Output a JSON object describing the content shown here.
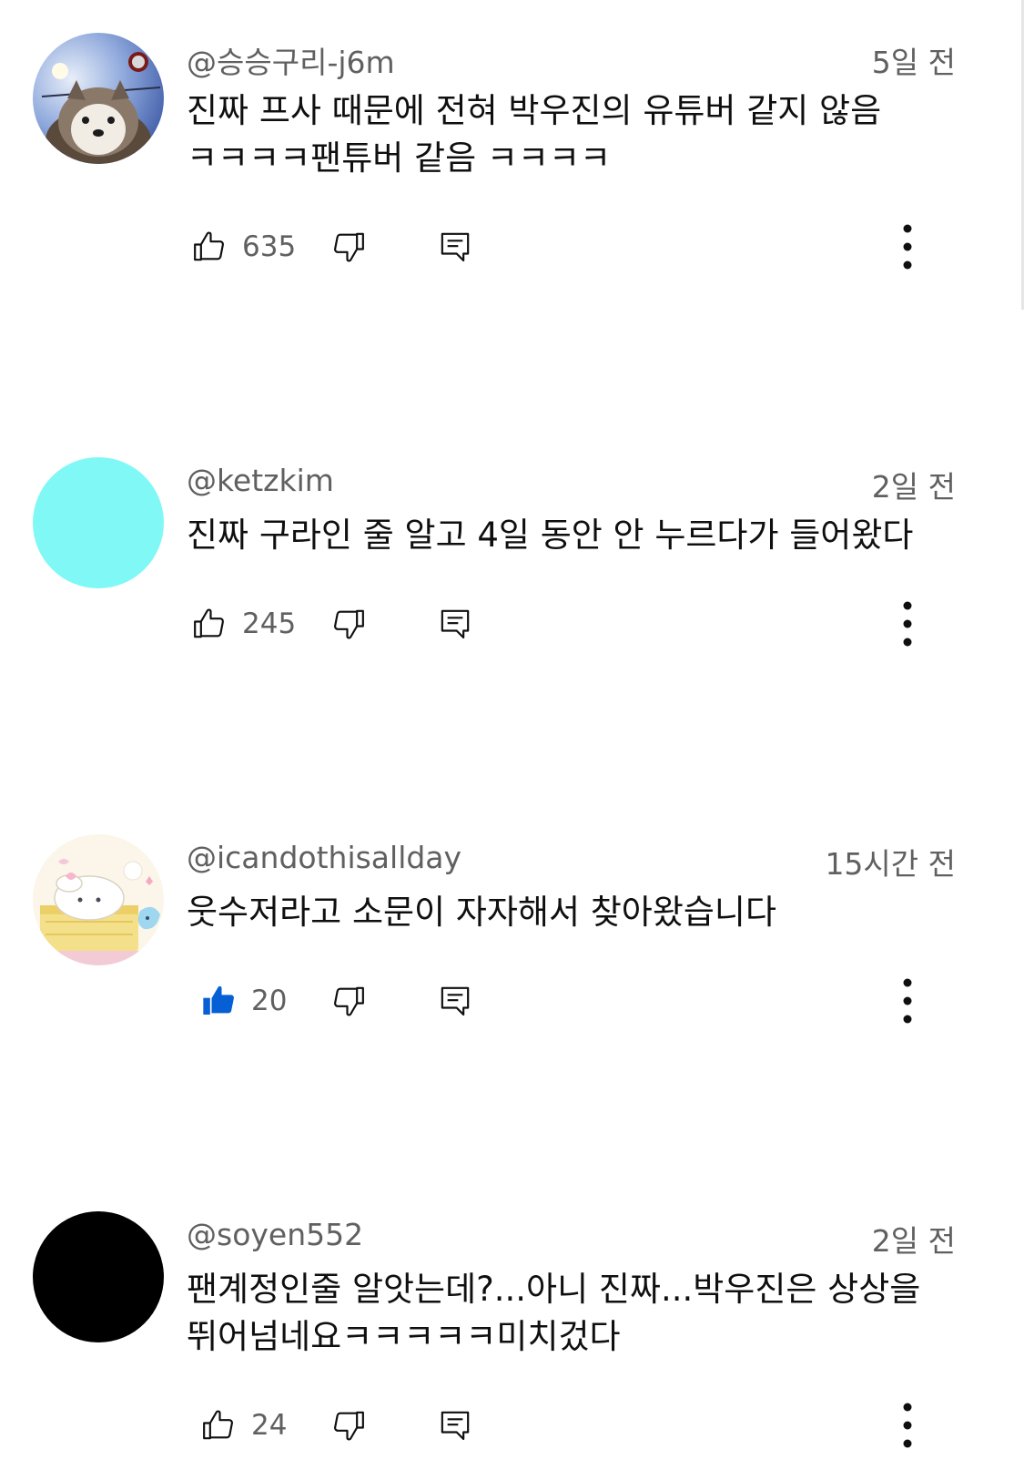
{
  "comments": [
    {
      "author": "@승승구리-j6m",
      "time": "5일 전",
      "text": "진짜 프사 때문에 전혀 박우진의 유튜버 같지 않음 ㅋㅋㅋㅋ팬튜버 같음 ㅋㅋㅋㅋ",
      "likes": "635",
      "liked": false,
      "avatar": "husky-dog-photo"
    },
    {
      "author": "@ketzkim",
      "time": "2일 전",
      "text": "진짜 구라인 줄 알고 4일 동안 안 누르다가 들어왔다",
      "likes": "245",
      "liked": false,
      "avatar": "cyan-circle",
      "avatar_color": "#80f8f6"
    },
    {
      "author": "@icandothisallday",
      "time": "15시간 전",
      "text": "웃수저라고 소문이 자자해서 찾아왔습니다",
      "likes": "20",
      "liked": true,
      "avatar": "cinnamoroll-illustration"
    },
    {
      "author": "@soyen552",
      "time": "2일 전",
      "text": "팬계정인줄 알앗는데?...아니 진짜...박우진은 상상을 뛰어넘네요ㅋㅋㅋㅋㅋ미치겄다",
      "likes": "24",
      "liked": false,
      "avatar": "black-circle",
      "avatar_color": "#000000"
    }
  ],
  "colors": {
    "meta_text": "#606060",
    "body_text": "#0f0f0f",
    "liked_blue": "#065fd4",
    "icon": "#0f0f0f"
  }
}
